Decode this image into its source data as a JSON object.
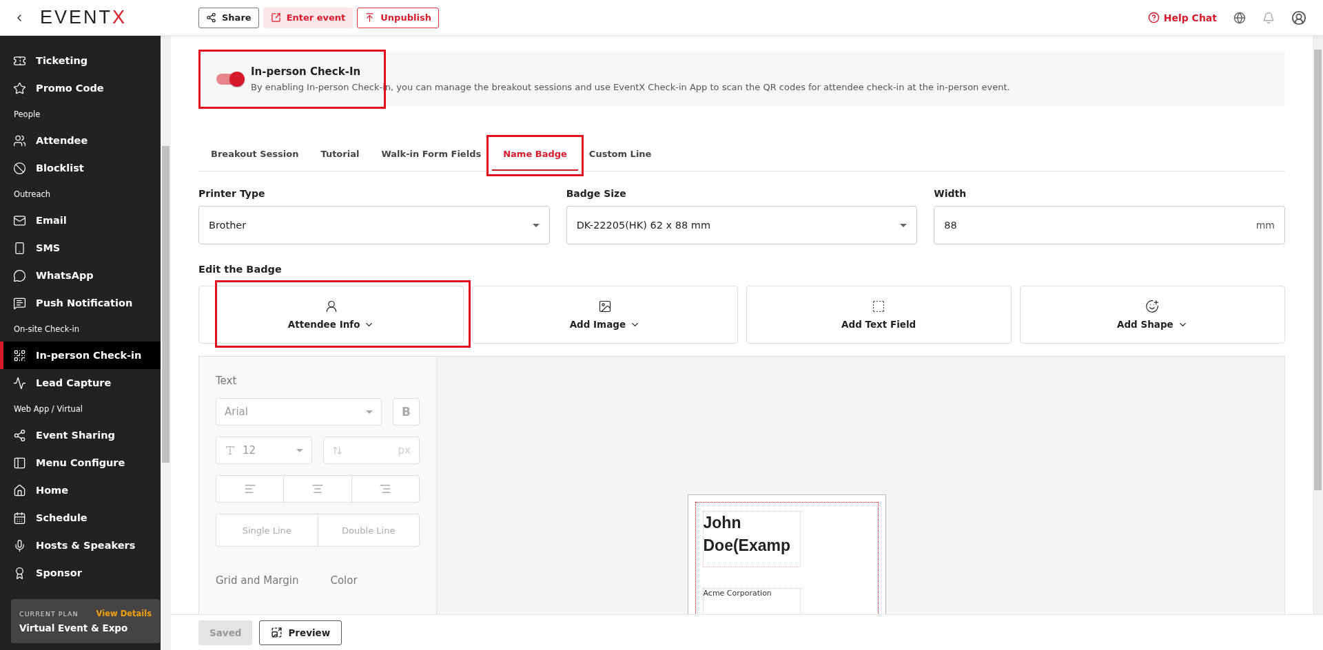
{
  "header": {
    "logo": {
      "text": "EVENT",
      "accent": "X"
    },
    "actions": [
      {
        "kind": "outline",
        "label": "Share"
      },
      {
        "kind": "tint",
        "label": "Enter event"
      },
      {
        "kind": "danger",
        "label": "Unpublish"
      }
    ],
    "help": "Help Chat"
  },
  "sidebar": {
    "items": [
      {
        "kind": "item",
        "label": "Ticketing",
        "selected": false
      },
      {
        "kind": "item",
        "label": "Promo Code",
        "selected": false
      },
      {
        "kind": "section",
        "label": "People"
      },
      {
        "kind": "item",
        "label": "Attendee",
        "selected": false
      },
      {
        "kind": "item",
        "label": "Blocklist",
        "selected": false
      },
      {
        "kind": "section",
        "label": "Outreach"
      },
      {
        "kind": "item",
        "label": "Email",
        "selected": false
      },
      {
        "kind": "item",
        "label": "SMS",
        "selected": false
      },
      {
        "kind": "item",
        "label": "WhatsApp",
        "selected": false
      },
      {
        "kind": "item",
        "label": "Push Notification",
        "selected": false
      },
      {
        "kind": "section",
        "label": "On-site Check-in"
      },
      {
        "kind": "item",
        "label": "In-person Check-in",
        "selected": true
      },
      {
        "kind": "item",
        "label": "Lead Capture",
        "selected": false
      },
      {
        "kind": "section",
        "label": "Web App / Virtual"
      },
      {
        "kind": "item",
        "label": "Event Sharing",
        "selected": false
      },
      {
        "kind": "item",
        "label": "Menu Configure",
        "selected": false
      },
      {
        "kind": "item",
        "label": "Home",
        "selected": false
      },
      {
        "kind": "item",
        "label": "Schedule",
        "selected": false
      },
      {
        "kind": "item",
        "label": "Hosts & Speakers",
        "selected": false
      },
      {
        "kind": "item",
        "label": "Sponsor",
        "selected": false
      }
    ],
    "plan": {
      "label": "CURRENT PLAN",
      "link": "View Details",
      "name": "Virtual Event & Expo"
    }
  },
  "toggle": {
    "on": true,
    "highlighted": true,
    "title": "In-person Check-In",
    "description": "By enabling In-person Check-in, you can manage the breakout sessions and use EventX Check-in App to scan the QR codes for attendee check-in at the in-person event."
  },
  "tabs": [
    {
      "label": "Breakout Session",
      "selected": false,
      "highlighted": false
    },
    {
      "label": "Tutorial",
      "selected": false,
      "highlighted": false
    },
    {
      "label": "Walk-in Form Fields",
      "selected": false,
      "highlighted": false
    },
    {
      "label": "Name Badge",
      "selected": true,
      "highlighted": true
    },
    {
      "label": "Custom Line",
      "selected": false,
      "highlighted": false
    }
  ],
  "fields": [
    {
      "kind": "select",
      "label": "Printer Type",
      "value": "Brother"
    },
    {
      "kind": "select",
      "label": "Badge Size",
      "value": "DK-22205(HK) 62 x 88 mm"
    },
    {
      "kind": "input",
      "label": "Width",
      "value": "88",
      "unit": "mm"
    }
  ],
  "edit_title": "Edit the Badge",
  "tools": [
    {
      "label": "Attendee Info",
      "dropdown": true,
      "highlighted": true
    },
    {
      "label": "Add Image",
      "dropdown": true,
      "highlighted": false
    },
    {
      "label": "Add Text Field",
      "dropdown": false,
      "highlighted": false
    },
    {
      "label": "Add Shape",
      "dropdown": true,
      "highlighted": false
    }
  ],
  "text_panel": {
    "title": "Text",
    "font": "Arial",
    "bold": "B",
    "size": "12",
    "unit": "px",
    "line_options": [
      "Single Line",
      "Double Line"
    ],
    "grid_title": "Grid and Margin",
    "color_title": "Color"
  },
  "badge": {
    "name": "John Doe(Examp",
    "company": "Acme Corporation"
  },
  "footer": [
    {
      "label": "Saved",
      "disabled": true
    },
    {
      "label": "Preview",
      "disabled": false
    }
  ]
}
